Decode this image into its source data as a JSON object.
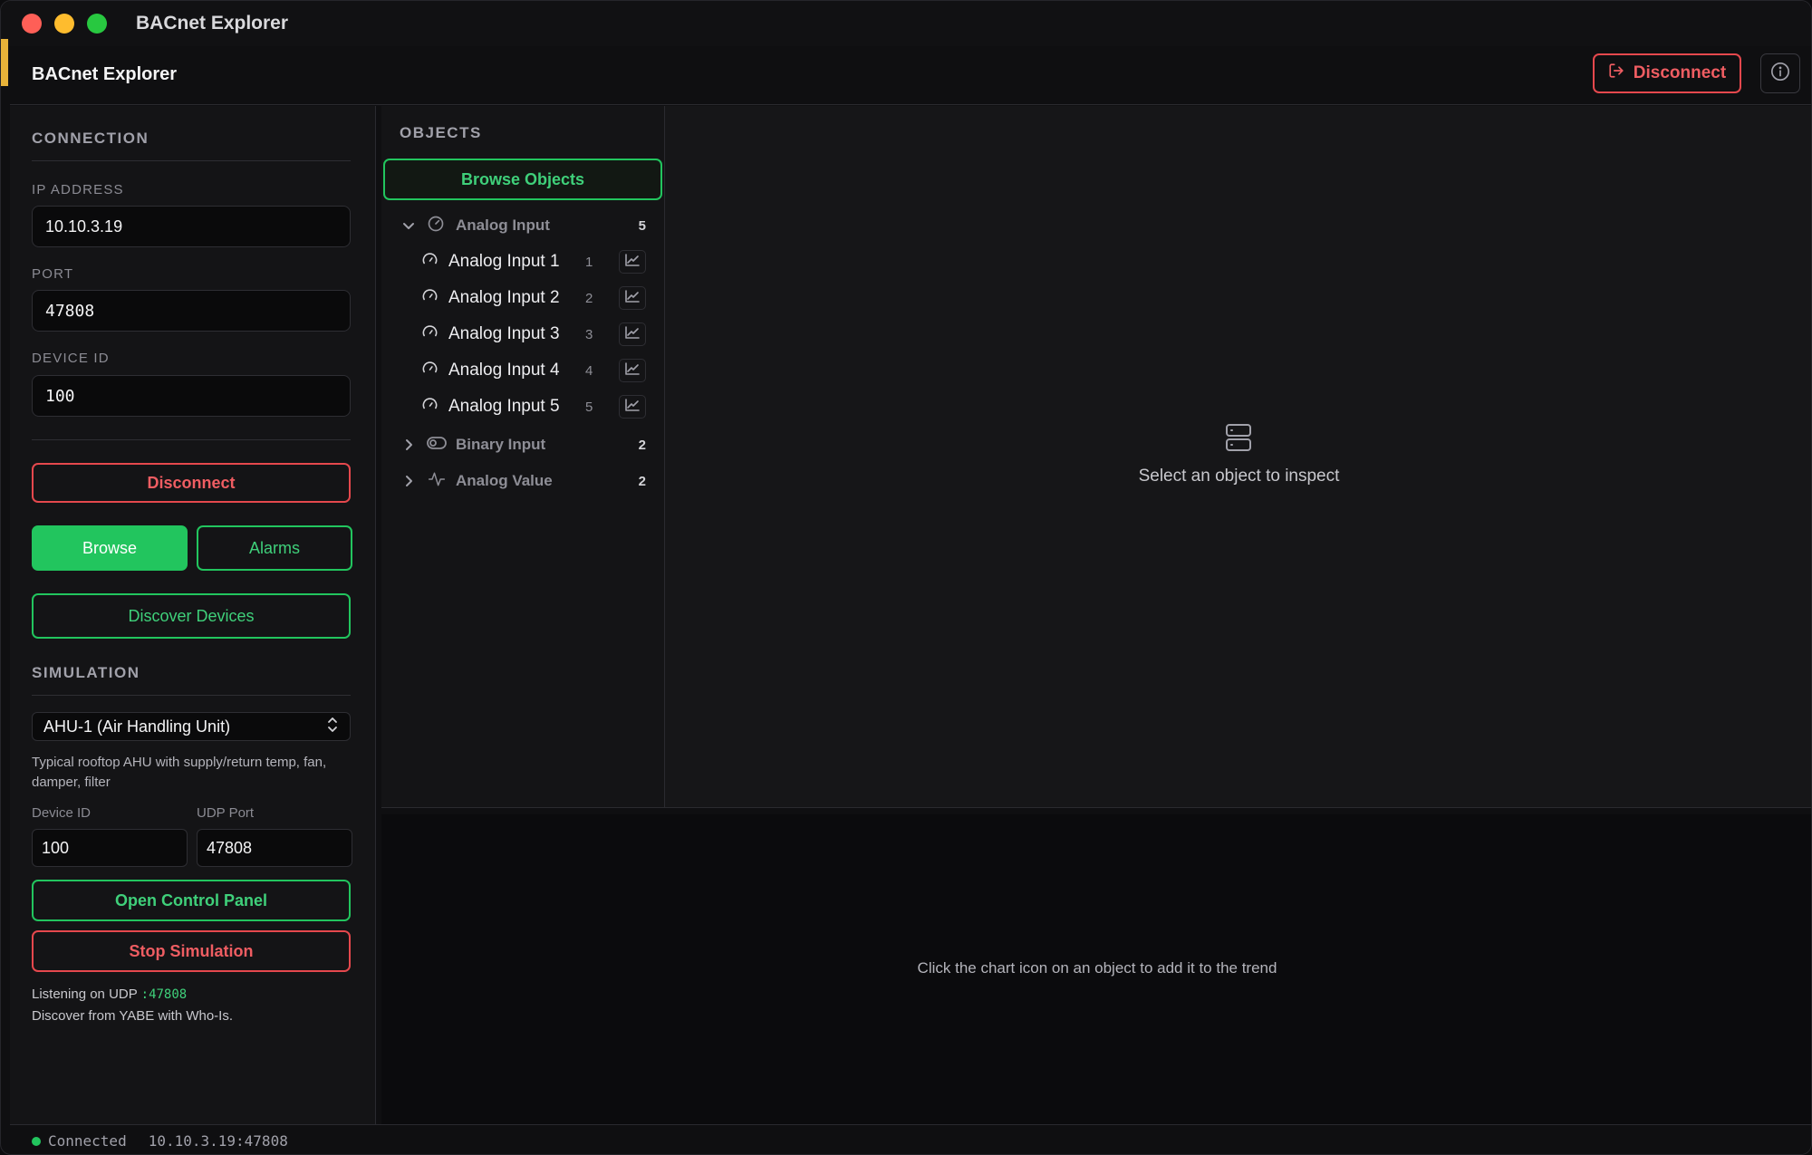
{
  "window": {
    "title": "BACnet Explorer"
  },
  "header": {
    "title": "BACnet Explorer",
    "disconnect_label": "Disconnect",
    "disconnect_icon": "logout-icon",
    "info_icon": "info-icon"
  },
  "connection": {
    "section_title": "CONNECTION",
    "ip_label": "IP ADDRESS",
    "ip_value": "10.10.3.19",
    "port_label": "PORT",
    "port_value": "47808",
    "device_label": "DEVICE ID",
    "device_value": "100",
    "disconnect_label": "Disconnect",
    "browse_label": "Browse",
    "alarms_label": "Alarms",
    "discover_label": "Discover Devices"
  },
  "simulation": {
    "section_title": "SIMULATION",
    "selected": "AHU-1 (Air Handling Unit)",
    "description": "Typical rooftop AHU with supply/return temp, fan, damper, filter",
    "device_label": "Device ID",
    "device_value": "100",
    "udp_label": "UDP Port",
    "udp_value": "47808",
    "open_panel_label": "Open Control Panel",
    "stop_label": "Stop Simulation",
    "listening_prefix": "Listening on UDP",
    "listening_port": ":47808",
    "discover_hint": "Discover from YABE with Who-Is."
  },
  "objects": {
    "title": "OBJECTS",
    "browse_label": "Browse Objects",
    "groups": [
      {
        "label": "Analog Input",
        "count": "5",
        "expanded": true,
        "icon": "gauge-icon",
        "items": [
          {
            "label": "Analog Input 1",
            "num": "1"
          },
          {
            "label": "Analog Input 2",
            "num": "2"
          },
          {
            "label": "Analog Input 3",
            "num": "3"
          },
          {
            "label": "Analog Input 4",
            "num": "4"
          },
          {
            "label": "Analog Input 5",
            "num": "5"
          }
        ]
      },
      {
        "label": "Binary Input",
        "count": "2",
        "expanded": false,
        "icon": "toggle-icon"
      },
      {
        "label": "Analog Value",
        "count": "2",
        "expanded": false,
        "icon": "activity-icon"
      }
    ]
  },
  "inspector": {
    "empty_text": "Select an object to inspect",
    "icon": "server-icon"
  },
  "trend": {
    "empty_text": "Click the chart icon on an object to add it to the trend"
  },
  "status": {
    "state": "Connected",
    "address": "10.10.3.19:47808"
  },
  "colors": {
    "accent_green": "#22c55e",
    "danger_red": "#e5484d",
    "background": "#0f0f11"
  }
}
